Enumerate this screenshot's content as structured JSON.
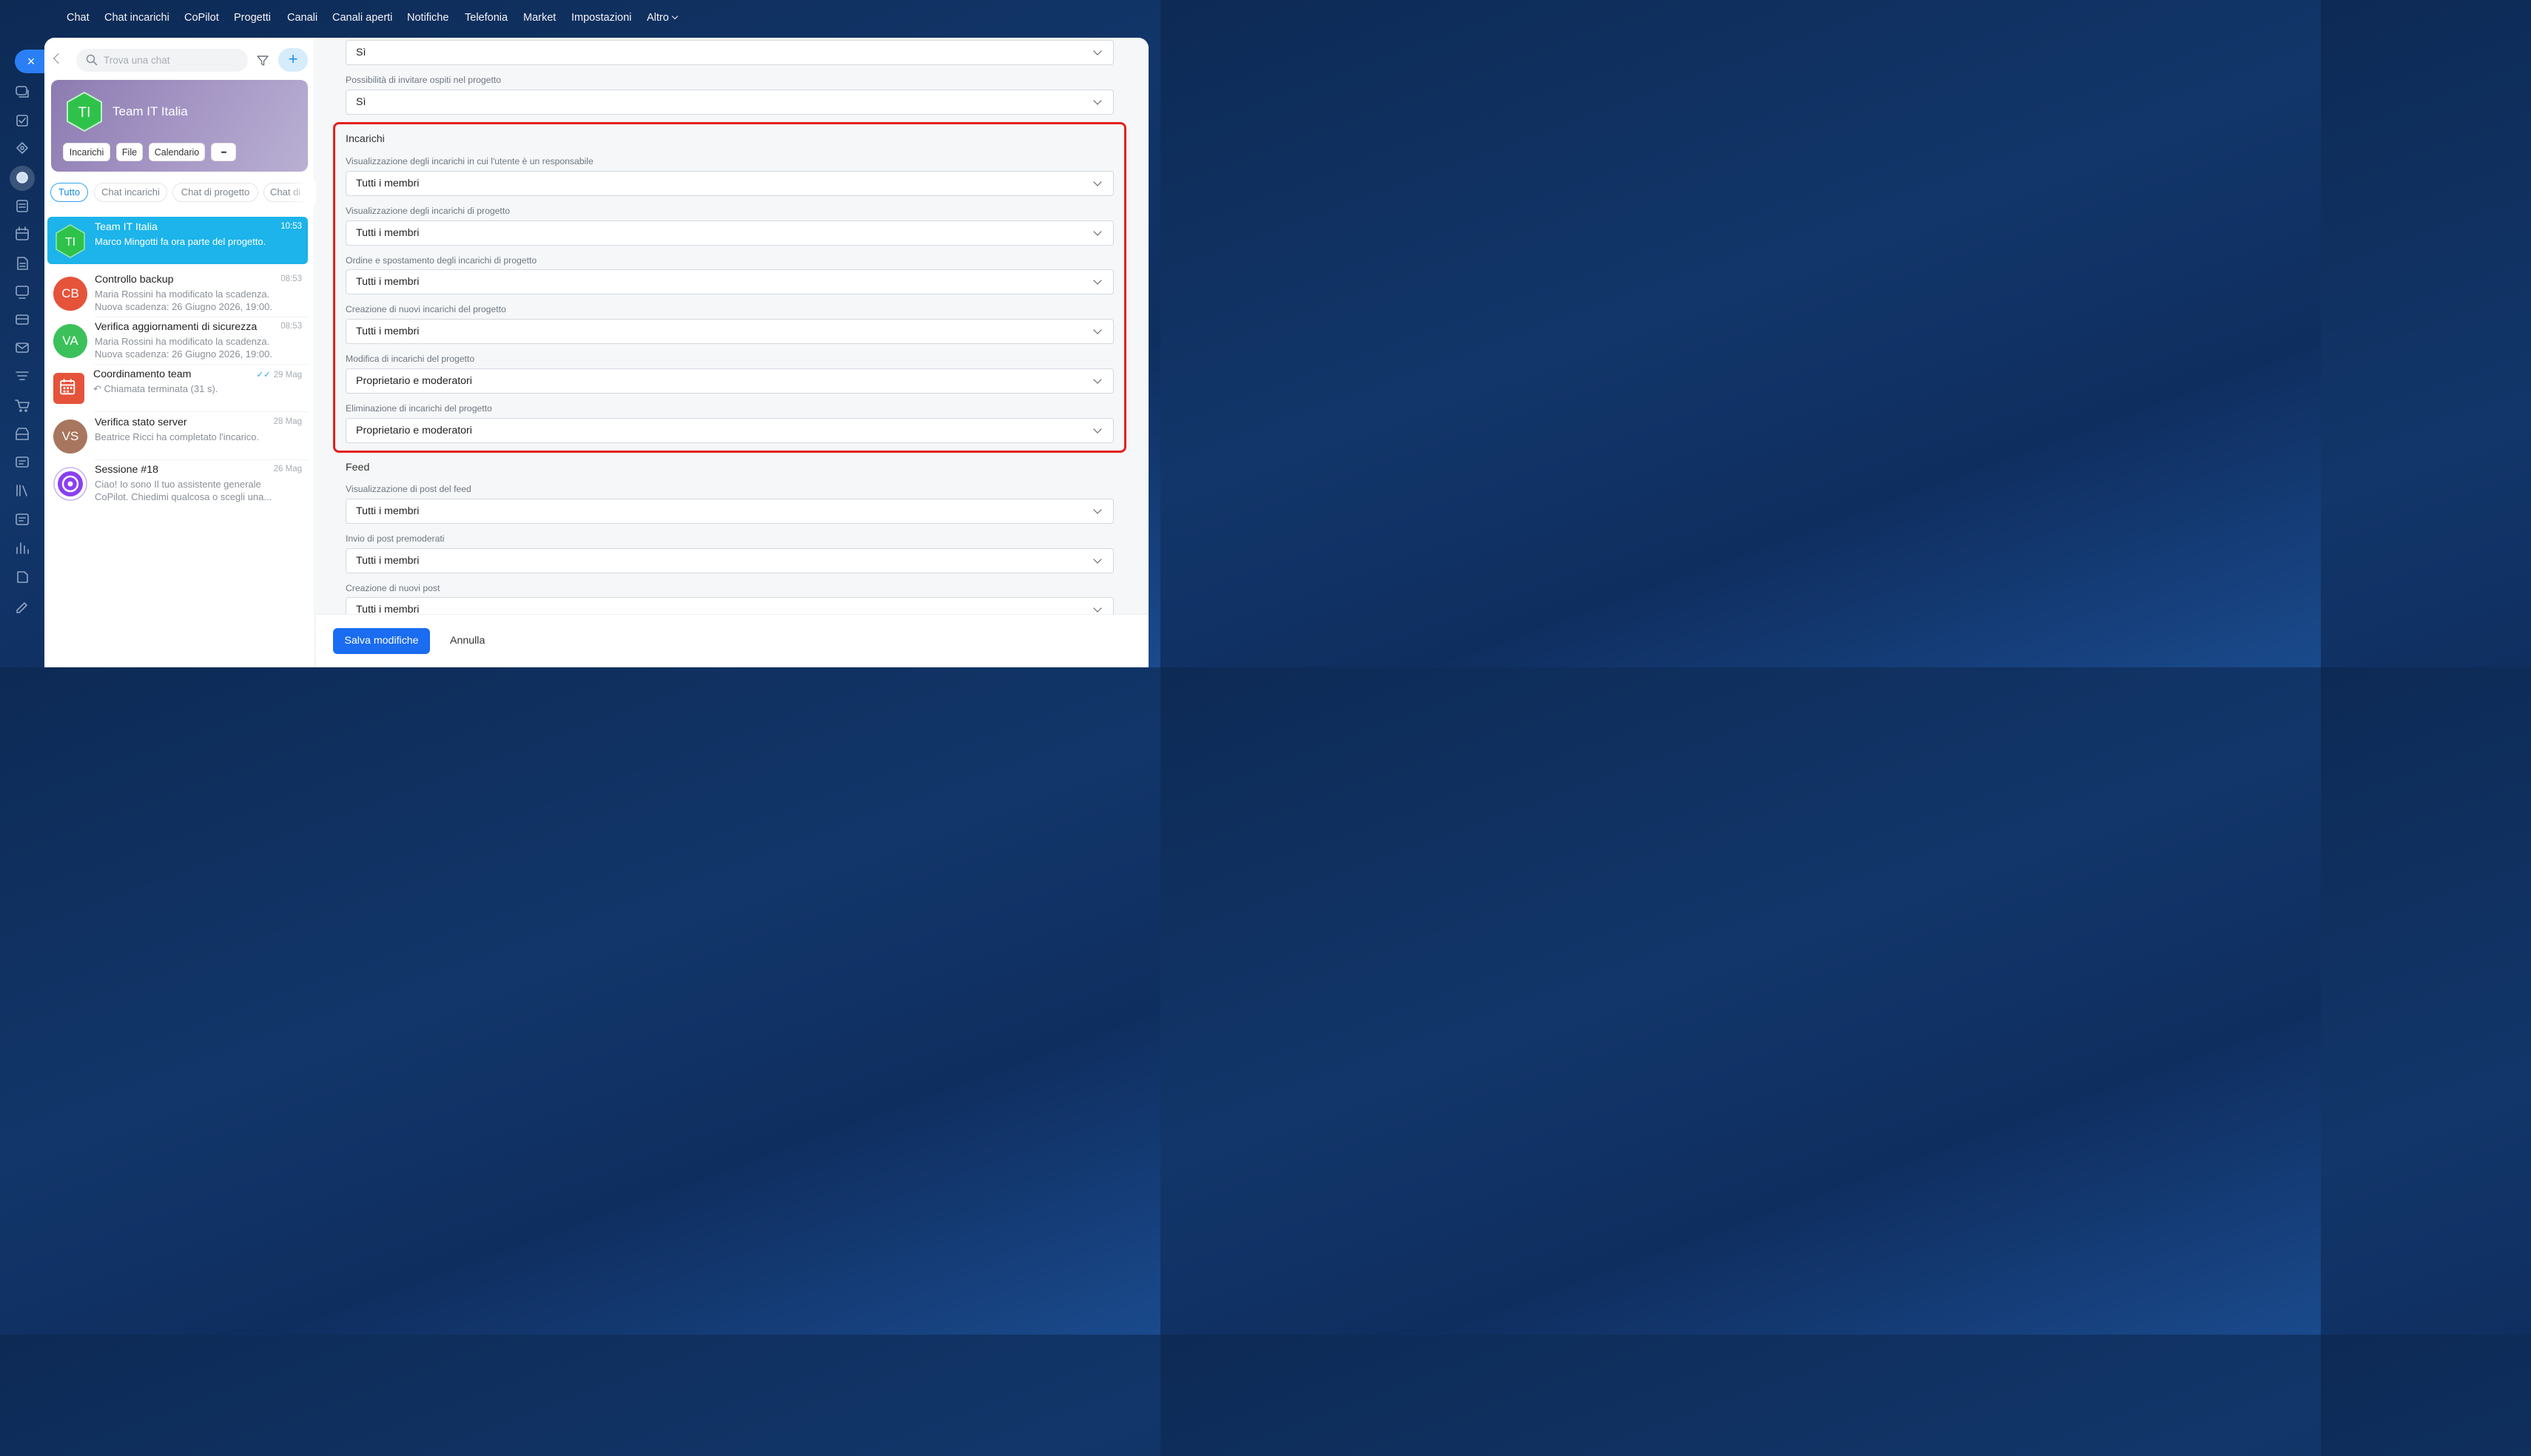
{
  "topnav": {
    "items": [
      "Chat",
      "Chat incarichi",
      "CoPilot",
      "Progetti",
      "Canali",
      "Canali aperti",
      "Notifiche",
      "Telefonia",
      "Market",
      "Impostazioni",
      "Altro"
    ]
  },
  "rail": {
    "close_label": "×",
    "icons": [
      "chat-icon",
      "tasks-icon",
      "copilot-icon",
      "projects-icon",
      "feed-icon",
      "calendar-icon",
      "documents-icon",
      "board-icon",
      "crm-icon",
      "mail-icon",
      "filter-icon",
      "cart-icon",
      "store-icon",
      "sites-icon",
      "library-icon",
      "planner-icon",
      "analytics-icon",
      "form-icon",
      "edit-icon"
    ]
  },
  "sidebar": {
    "search_placeholder": "Trova una chat",
    "plus_label": "+",
    "team": {
      "initials": "TI",
      "name": "Team IT Italia",
      "buttons": [
        "Incarichi",
        "File",
        "Calendario",
        "•••"
      ]
    },
    "filters": [
      "Tutto",
      "Chat incarichi",
      "Chat di progetto",
      "Chat di"
    ],
    "chats": [
      {
        "initials": "TI",
        "title": "Team IT Italia",
        "time": "10:53",
        "line1": "Marco Mingotti fa ora parte del progetto.",
        "line2": ""
      },
      {
        "initials": "CB",
        "title": "Controllo backup",
        "time": "08:53",
        "line1": "Maria Rossini ha modificato la scadenza.",
        "line2": "Nuova scadenza: 26 Giugno 2026, 19:00."
      },
      {
        "initials": "VA",
        "title": "Verifica aggiornamenti di sicurezza",
        "time": "08:53",
        "line1": "Maria Rossini ha modificato la scadenza.",
        "line2": "Nuova scadenza: 26 Giugno 2026, 19:00."
      },
      {
        "initials": "",
        "title": "Coordinamento team",
        "time": "29 Mag",
        "line1": "↶ Chiamata terminata (31 s).",
        "line2": ""
      },
      {
        "initials": "VS",
        "title": "Verifica stato server",
        "time": "28 Mag",
        "line1": "Beatrice Ricci ha completato l'incarico.",
        "line2": ""
      },
      {
        "initials": "",
        "title": "Sessione #18",
        "time": "26 Mag",
        "line1": "Ciao! Io sono Il tuo assistente generale",
        "line2": "CoPilot. Chiedimi qualcosa o scegli una..."
      }
    ]
  },
  "settings": {
    "top_fields": [
      {
        "label": "",
        "value": "Sì"
      },
      {
        "label": "Possibilità di invitare ospiti nel progetto",
        "value": "Sì"
      }
    ],
    "tasks_section": {
      "title": "Incarichi",
      "fields": [
        {
          "label": "Visualizzazione degli incarichi in cui l'utente è un responsabile",
          "value": "Tutti i membri"
        },
        {
          "label": "Visualizzazione degli incarichi di progetto",
          "value": "Tutti i membri"
        },
        {
          "label": "Ordine e spostamento degli incarichi di progetto",
          "value": "Tutti i membri"
        },
        {
          "label": "Creazione di nuovi incarichi del progetto",
          "value": "Tutti i membri"
        },
        {
          "label": "Modifica di incarichi del progetto",
          "value": "Proprietario e moderatori"
        },
        {
          "label": "Eliminazione di incarichi del progetto",
          "value": "Proprietario e moderatori"
        }
      ]
    },
    "feed_section": {
      "title": "Feed",
      "fields": [
        {
          "label": "Visualizzazione di post del feed",
          "value": "Tutti i membri"
        },
        {
          "label": "Invio di post premoderati",
          "value": "Tutti i membri"
        },
        {
          "label": "Creazione di nuovi post",
          "value": "Tutti i membri"
        }
      ]
    }
  },
  "footer": {
    "save_label": "Salva modifiche",
    "cancel_label": "Annulla"
  },
  "colors": {
    "accent": "#1a6cf0",
    "selected_chat": "#1cb4ea",
    "highlight": "#e32020",
    "team_green": "#2fc24a"
  }
}
